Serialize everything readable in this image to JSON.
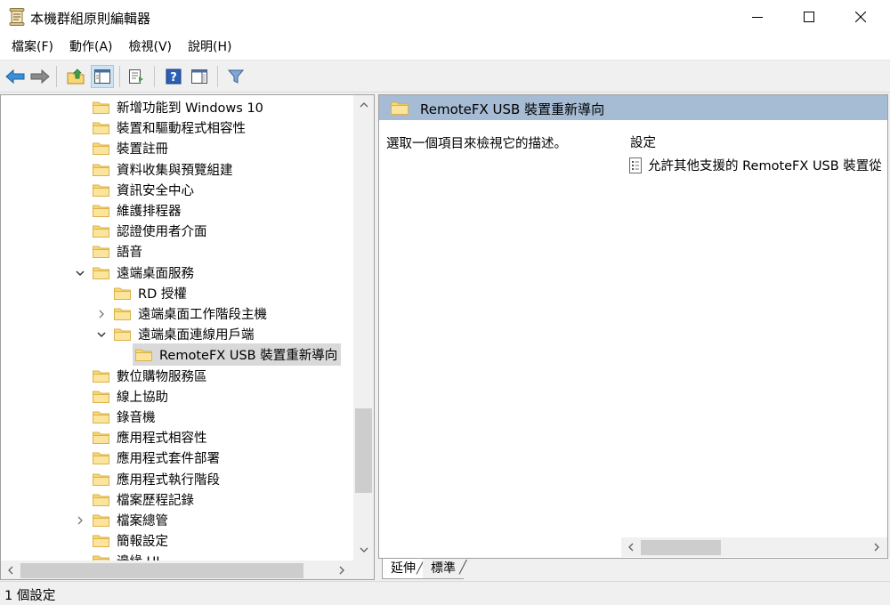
{
  "window": {
    "title": "本機群組原則編輯器",
    "icon": "policy-editor-icon",
    "controls": [
      "minimize-icon",
      "maximize-icon",
      "close-icon"
    ]
  },
  "menu": {
    "items": [
      "檔案(F)",
      "動作(A)",
      "檢視(V)",
      "說明(H)"
    ]
  },
  "toolbar": {
    "buttons": [
      "back-arrow-icon",
      "forward-arrow-icon",
      "up-folder-icon",
      "show-hide-tree-icon",
      "export-list-icon",
      "help-icon",
      "show-hide-action-pane-icon",
      "filter-icon"
    ]
  },
  "tree": {
    "items": [
      {
        "label": "新增功能到 Windows 10",
        "level": 0,
        "expander": "none"
      },
      {
        "label": "裝置和驅動程式相容性",
        "level": 0,
        "expander": "none"
      },
      {
        "label": "裝置註冊",
        "level": 0,
        "expander": "none"
      },
      {
        "label": "資料收集與預覽組建",
        "level": 0,
        "expander": "none"
      },
      {
        "label": "資訊安全中心",
        "level": 0,
        "expander": "none"
      },
      {
        "label": "維護排程器",
        "level": 0,
        "expander": "none"
      },
      {
        "label": "認證使用者介面",
        "level": 0,
        "expander": "none"
      },
      {
        "label": "語音",
        "level": 0,
        "expander": "none"
      },
      {
        "label": "遠端桌面服務",
        "level": 0,
        "expander": "expanded"
      },
      {
        "label": "RD 授權",
        "level": 1,
        "expander": "none"
      },
      {
        "label": "遠端桌面工作階段主機",
        "level": 1,
        "expander": "collapsed"
      },
      {
        "label": "遠端桌面連線用戶端",
        "level": 1,
        "expander": "expanded"
      },
      {
        "label": "RemoteFX USB 裝置重新導向",
        "level": 2,
        "expander": "none",
        "selected": true
      },
      {
        "label": "數位購物服務區",
        "level": 0,
        "expander": "none"
      },
      {
        "label": "線上協助",
        "level": 0,
        "expander": "none"
      },
      {
        "label": "錄音機",
        "level": 0,
        "expander": "none"
      },
      {
        "label": "應用程式相容性",
        "level": 0,
        "expander": "none"
      },
      {
        "label": "應用程式套件部署",
        "level": 0,
        "expander": "none"
      },
      {
        "label": "應用程式執行階段",
        "level": 0,
        "expander": "none"
      },
      {
        "label": "檔案歷程記錄",
        "level": 0,
        "expander": "none"
      },
      {
        "label": "檔案總管",
        "level": 0,
        "expander": "collapsed"
      },
      {
        "label": "簡報設定",
        "level": 0,
        "expander": "none"
      },
      {
        "label": "邊緣 UI",
        "level": 0,
        "expander": "none"
      }
    ]
  },
  "details": {
    "header_title": "RemoteFX USB 裝置重新導向",
    "description": "選取一個項目來檢視它的描述。",
    "column_header": "設定",
    "policies": [
      "允許其他支援的 RemoteFX USB 裝置從"
    ]
  },
  "tabs": {
    "extended": "延伸",
    "standard": "標準"
  },
  "status": {
    "text": "1 個設定"
  },
  "colors": {
    "header_bg": "#a6bbd4",
    "selection_bg": "#d9d9d9",
    "folder_yellow": "#f8d775",
    "folder_dark": "#dcb14a"
  }
}
